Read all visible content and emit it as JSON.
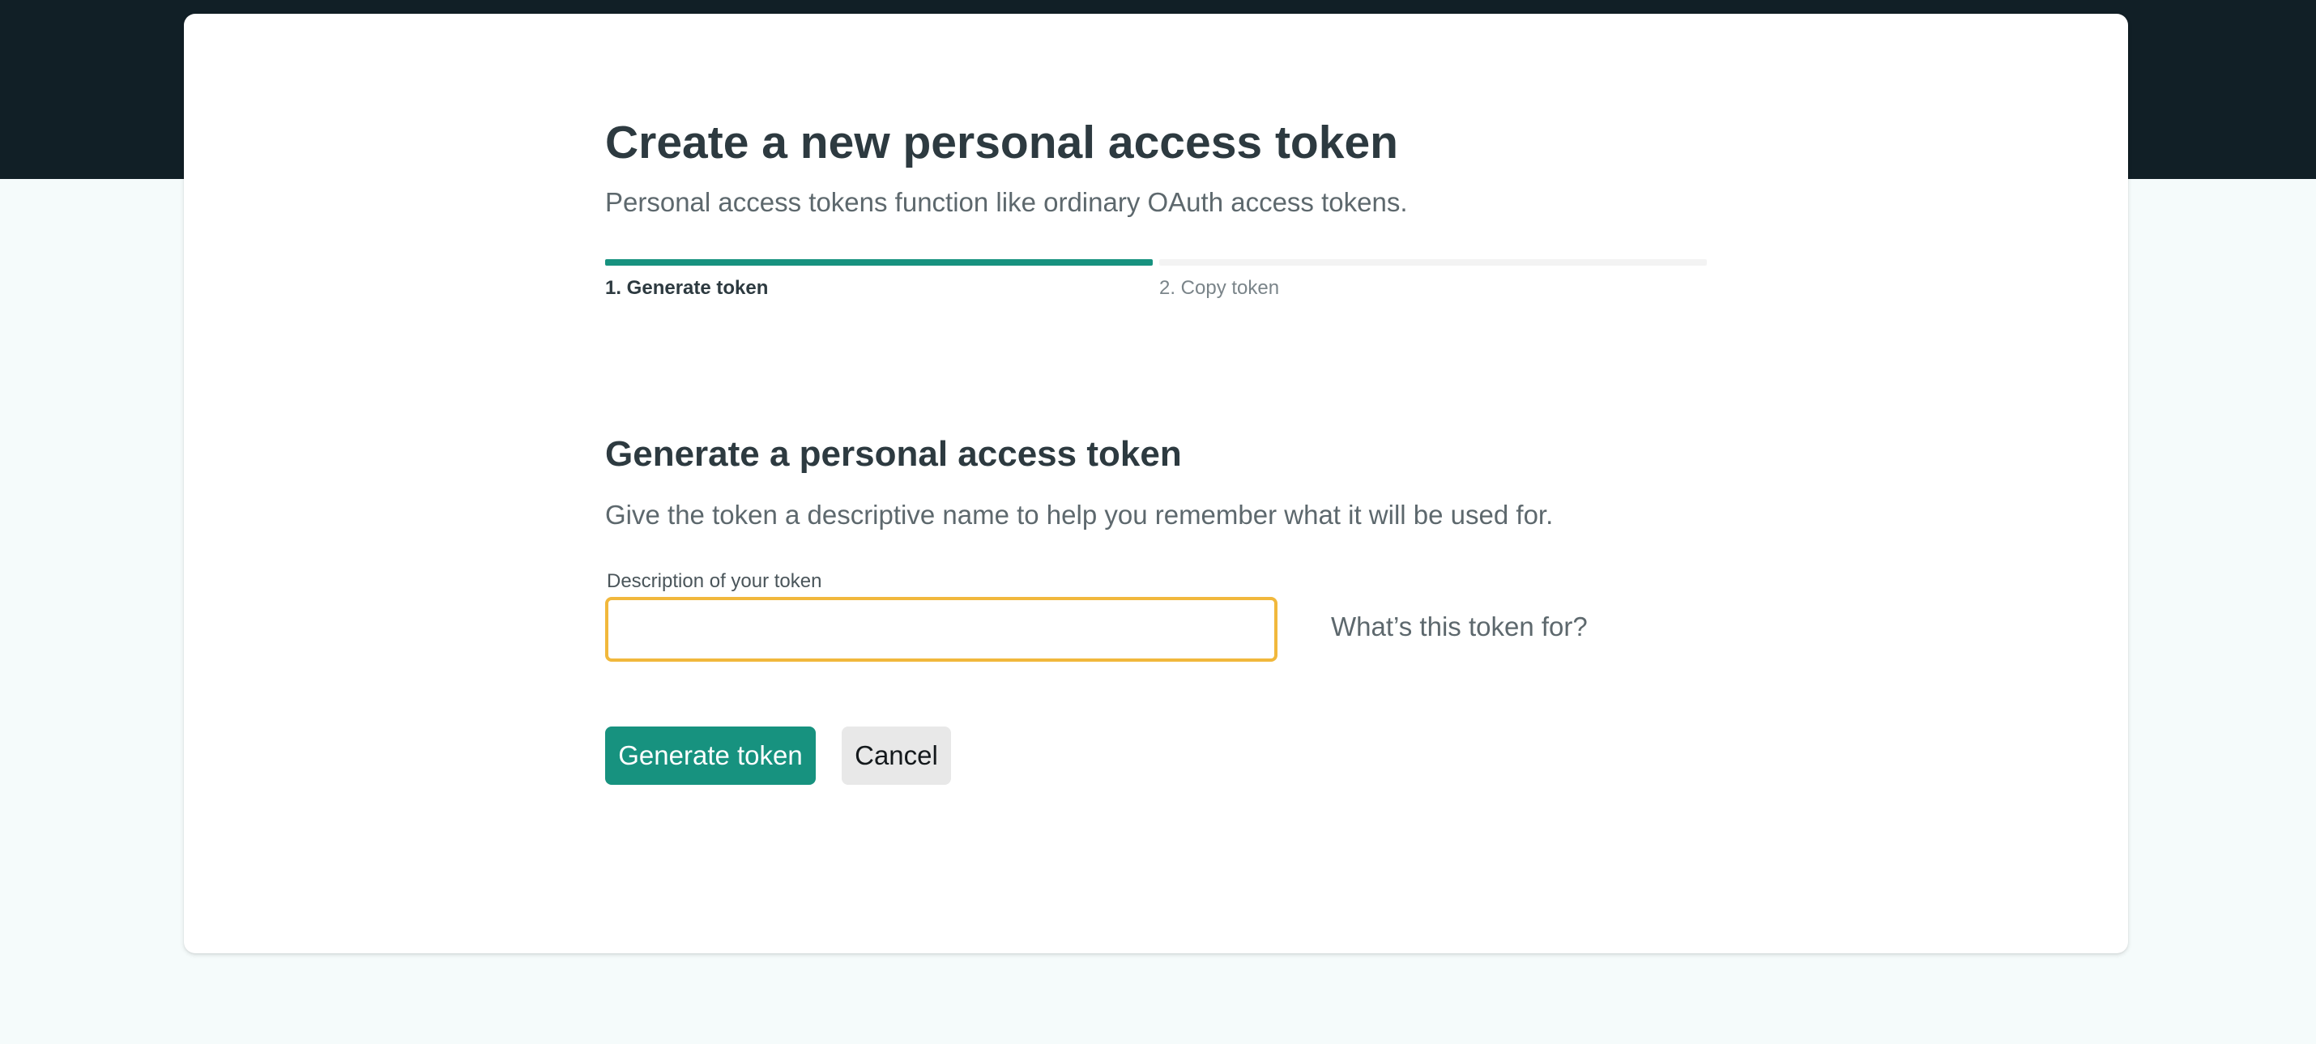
{
  "header": {
    "title": "Create a new personal access token",
    "subtitle": "Personal access tokens function like ordinary OAuth access tokens."
  },
  "stepper": {
    "steps": [
      {
        "label": "1. Generate token",
        "active": true
      },
      {
        "label": "2. Copy token",
        "active": false
      }
    ]
  },
  "form": {
    "title": "Generate a personal access token",
    "subtitle": "Give the token a descriptive name to help you remember what it will be used for.",
    "description_label": "Description of your token",
    "description_value": "",
    "description_hint": "What’s this token for?",
    "generate_label": "Generate token",
    "cancel_label": "Cancel"
  },
  "colors": {
    "accent": "#17927f",
    "focus_ring": "#f1b83c",
    "top_band": "#111f26",
    "page_background": "#f5fbfb"
  }
}
